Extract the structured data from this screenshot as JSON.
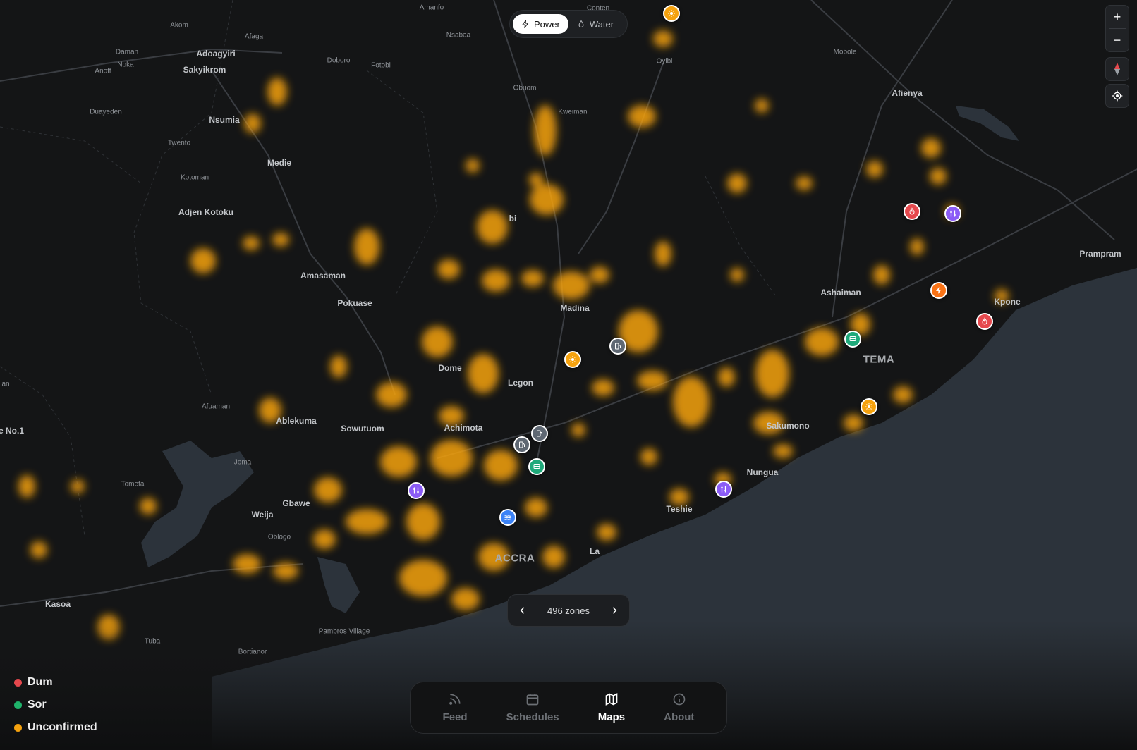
{
  "mode_toggle": {
    "options": [
      {
        "label": "Power",
        "icon": "lightning-icon",
        "active": true
      },
      {
        "label": "Water",
        "icon": "droplet-icon",
        "active": false
      }
    ]
  },
  "zoom_controls": {
    "zoom_in": "+",
    "zoom_out": "−"
  },
  "zones_pager": {
    "label": "496 zones"
  },
  "legend": {
    "items": [
      {
        "label": "Dum",
        "color": "#e5484d"
      },
      {
        "label": "Sor",
        "color": "#1fb36b"
      },
      {
        "label": "Unconfirmed",
        "color": "#f5a20e"
      }
    ]
  },
  "tabbar": {
    "tabs": [
      {
        "label": "Feed",
        "icon": "rss-icon",
        "active": false
      },
      {
        "label": "Schedules",
        "icon": "calendar-icon",
        "active": false
      },
      {
        "label": "Maps",
        "icon": "map-icon",
        "active": true
      },
      {
        "label": "About",
        "icon": "info-icon",
        "active": false
      }
    ]
  },
  "colors": {
    "heat": "#f5a20e",
    "sea": "#2c333b",
    "land": "#141516",
    "marker_orange": "#f5a20e",
    "marker_red": "#e5484d",
    "marker_purple": "#8b5cf6",
    "marker_green": "#1fa97a",
    "marker_gray": "#5f6873",
    "marker_blue": "#3b82f6",
    "marker_darkorange": "#f97316"
  },
  "places": [
    {
      "name": "Amanfo",
      "size": "sm"
    },
    {
      "name": "Conten",
      "size": "sm"
    },
    {
      "name": "Akom",
      "size": "sm"
    },
    {
      "name": "Afaga",
      "size": "sm"
    },
    {
      "name": "Nsabaa",
      "size": "sm"
    },
    {
      "name": "Daman",
      "size": "sm"
    },
    {
      "name": "Adoagyiri",
      "size": "md"
    },
    {
      "name": "Noka",
      "size": "sm"
    },
    {
      "name": "Anoff",
      "size": "sm"
    },
    {
      "name": "Sakyikrom",
      "size": "md"
    },
    {
      "name": "Doboro",
      "size": "sm"
    },
    {
      "name": "Fotobi",
      "size": "sm"
    },
    {
      "name": "Oyibi",
      "size": "sm"
    },
    {
      "name": "Mobole",
      "size": "sm"
    },
    {
      "name": "Obuom",
      "size": "sm"
    },
    {
      "name": "Afienya",
      "size": "md"
    },
    {
      "name": "Duayeden",
      "size": "sm"
    },
    {
      "name": "Kweiman",
      "size": "sm"
    },
    {
      "name": "Nsumia",
      "size": "md"
    },
    {
      "name": "Twento",
      "size": "sm"
    },
    {
      "name": "Medie",
      "size": "md"
    },
    {
      "name": "Kotoman",
      "size": "sm"
    },
    {
      "name": "Adjen Kotoku",
      "size": "md"
    },
    {
      "name": "bi",
      "size": "md"
    },
    {
      "name": "Prampram",
      "size": "md"
    },
    {
      "name": "Amasaman",
      "size": "md"
    },
    {
      "name": "Ashaiman",
      "size": "md"
    },
    {
      "name": "Pokuase",
      "size": "md"
    },
    {
      "name": "Kpone",
      "size": "md"
    },
    {
      "name": "Madina",
      "size": "md"
    },
    {
      "name": "TEMA",
      "size": "lg"
    },
    {
      "name": "Dome",
      "size": "md"
    },
    {
      "name": "Legon",
      "size": "md"
    },
    {
      "name": "an",
      "size": "sm"
    },
    {
      "name": "Afuaman",
      "size": "sm"
    },
    {
      "name": "Ablekuma",
      "size": "md"
    },
    {
      "name": "Sowutuom",
      "size": "md"
    },
    {
      "name": "Achimota",
      "size": "md"
    },
    {
      "name": "Sakumono",
      "size": "md"
    },
    {
      "name": "e No.1",
      "size": "md"
    },
    {
      "name": "Joma",
      "size": "sm"
    },
    {
      "name": "Nungua",
      "size": "md"
    },
    {
      "name": "Tomefa",
      "size": "sm"
    },
    {
      "name": "Gbawe",
      "size": "md"
    },
    {
      "name": "Teshie",
      "size": "md"
    },
    {
      "name": "Weija",
      "size": "md"
    },
    {
      "name": "Oblogo",
      "size": "sm"
    },
    {
      "name": "ACCRA",
      "size": "lg"
    },
    {
      "name": "La",
      "size": "md"
    },
    {
      "name": "Kasoa",
      "size": "md"
    },
    {
      "name": "Pambros Village",
      "size": "sm"
    },
    {
      "name": "Tuba",
      "size": "sm"
    },
    {
      "name": "Bortianor",
      "size": "sm"
    }
  ]
}
